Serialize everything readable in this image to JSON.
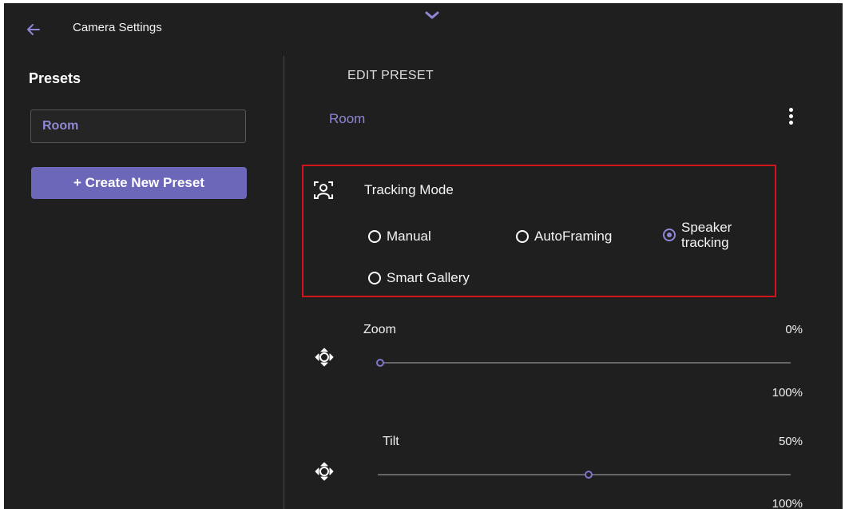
{
  "header": {
    "title": "Camera Settings",
    "back_icon": "arrow-left-icon",
    "expand_icon": "chevron-down-icon"
  },
  "sidebar": {
    "title": "Presets",
    "presets": [
      {
        "label": "Room",
        "selected": true
      }
    ],
    "create_button": "+ Create New Preset"
  },
  "main": {
    "section_title": "EDIT PRESET",
    "preset_name": "Room",
    "menu_icon": "more-vertical-icon",
    "tracking": {
      "title": "Tracking Mode",
      "icon": "person-frame-icon",
      "options": [
        {
          "label": "Manual",
          "selected": false
        },
        {
          "label": "AutoFraming",
          "selected": false
        },
        {
          "label": "Speaker tracking",
          "selected": true
        },
        {
          "label": "Smart Gallery",
          "selected": false
        }
      ]
    },
    "zoom": {
      "label": "Zoom",
      "value_text": "0%",
      "max_text": "100%",
      "value": 0,
      "icon": "move-arrows-icon"
    },
    "tilt": {
      "label": "Tilt",
      "value_text": "50%",
      "max_text": "100%",
      "value": 50,
      "icon": "move-arrows-icon"
    }
  },
  "colors": {
    "accent": "#8e87d6",
    "button": "#6c67b8",
    "background": "#201f1f",
    "highlight_border": "#d1141b"
  }
}
